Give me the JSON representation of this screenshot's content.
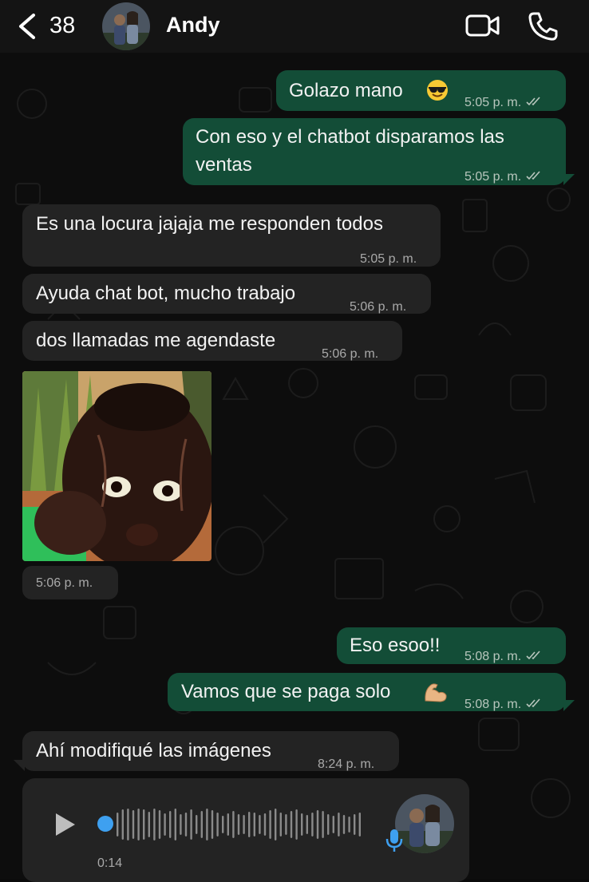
{
  "header": {
    "back_count": "38",
    "contact_name": "Andy",
    "icons": [
      "chevron-left-icon",
      "video-camera-icon",
      "phone-icon"
    ]
  },
  "messages": [
    {
      "direction": "out",
      "text": "Golazo mano",
      "emoji": "smiling-face-with-sunglasses",
      "time": "5:05 p. m.",
      "status": "read"
    },
    {
      "direction": "out",
      "text_line1": "Con eso y el chatbot disparamos las",
      "text_line2": "ventas",
      "time": "5:05 p. m.",
      "status": "read"
    },
    {
      "direction": "in",
      "text": "Es una locura jajaja me responden todos",
      "time": "5:05 p. m."
    },
    {
      "direction": "in",
      "text": "Ayuda chat bot, mucho trabajo",
      "time": "5:06 p. m."
    },
    {
      "direction": "in",
      "text": "dos llamadas me agendaste",
      "time": "5:06 p. m."
    },
    {
      "direction": "in",
      "type": "image",
      "time": "5:06 p. m."
    },
    {
      "direction": "out",
      "text": "Eso esoo!!",
      "time": "5:08 p. m.",
      "status": "read"
    },
    {
      "direction": "out",
      "text": "Vamos que se paga solo",
      "emoji": "flexed-biceps",
      "time": "5:08 p. m.",
      "status": "read"
    },
    {
      "direction": "in",
      "text": "Ahí modifiqué las imágenes",
      "time": "8:24 p. m."
    },
    {
      "direction": "in",
      "type": "voice",
      "duration": "0:14",
      "progress": 0
    }
  ],
  "colors": {
    "outgoing_bubble": "#134d37",
    "incoming_bubble": "#232323",
    "background": "#0d0d0d",
    "voice_accent": "#3ea0f0"
  }
}
